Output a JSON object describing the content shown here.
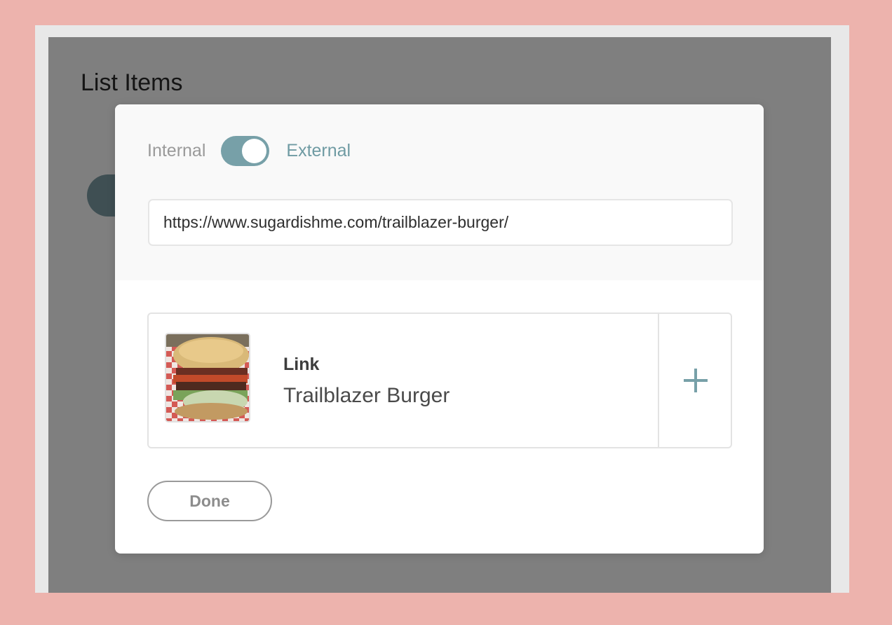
{
  "page": {
    "title": "List Items"
  },
  "link_modal": {
    "toggle": {
      "left_label": "Internal",
      "right_label": "External",
      "selected": "External",
      "accent_color": "#77a0a8"
    },
    "url_input": {
      "value": "https://www.sugardishme.com/trailblazer-burger/"
    },
    "result": {
      "type_label": "Link",
      "title": "Trailblazer Burger",
      "thumbnail": "burger-photo",
      "add_icon": "plus-icon"
    },
    "done_label": "Done"
  }
}
